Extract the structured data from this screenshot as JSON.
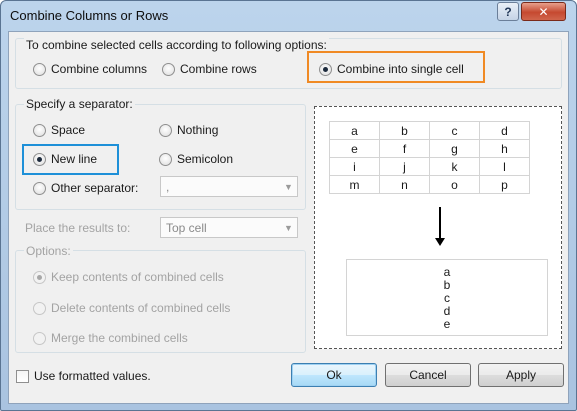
{
  "window": {
    "title": "Combine Columns or Rows",
    "help_icon": "?",
    "close_icon": "✕"
  },
  "combine_options": {
    "caption": "To combine selected cells according to following options:",
    "options": [
      {
        "label": "Combine columns",
        "checked": false
      },
      {
        "label": "Combine rows",
        "checked": false
      },
      {
        "label": "Combine into single cell",
        "checked": true
      }
    ]
  },
  "separator": {
    "caption": "Specify a separator:",
    "space": {
      "label": "Space",
      "checked": false
    },
    "nothing": {
      "label": "Nothing",
      "checked": false
    },
    "new_line": {
      "label": "New line",
      "checked": true
    },
    "semicolon": {
      "label": "Semicolon",
      "checked": false
    },
    "other": {
      "label": "Other separator:",
      "checked": false
    },
    "other_value": ","
  },
  "place_results": {
    "label": "Place the results to:",
    "value": "Top cell"
  },
  "options_group": {
    "caption": "Options:",
    "items": [
      {
        "label": "Keep contents of combined cells",
        "checked": true
      },
      {
        "label": "Delete contents of combined cells",
        "checked": false
      },
      {
        "label": "Merge the combined cells",
        "checked": false
      }
    ]
  },
  "preview": {
    "grid": [
      [
        "a",
        "b",
        "c",
        "d"
      ],
      [
        "e",
        "f",
        "g",
        "h"
      ],
      [
        "i",
        "j",
        "k",
        "l"
      ],
      [
        "m",
        "n",
        "o",
        "p"
      ]
    ],
    "result": [
      "a",
      "b",
      "c",
      "d",
      "e"
    ]
  },
  "footer": {
    "use_formatted_values": "Use formatted values.",
    "ok": "Ok",
    "cancel": "Cancel",
    "apply": "Apply"
  },
  "colors": {
    "highlight_single_cell": "#f08a24",
    "highlight_new_line": "#1e90d8"
  }
}
